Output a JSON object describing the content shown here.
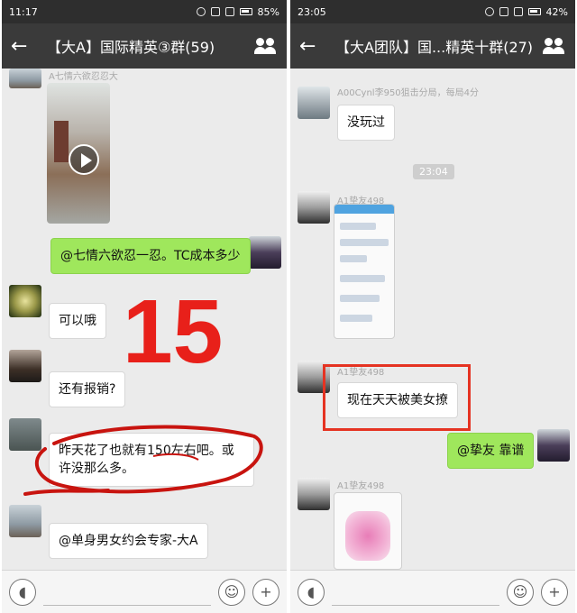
{
  "left": {
    "status": {
      "time": "11:17",
      "battery": "85%"
    },
    "title": "【大A】国际精英③群(59)",
    "messages": [
      {
        "sender": "A七情六欲忍忍大"
      },
      {
        "text": "@七情六欲忍一忍。TC成本多少"
      },
      {
        "text": "可以哦"
      },
      {
        "text": "还有报销?"
      },
      {
        "text": "昨天花了也就有150左右吧。或许没那么多。"
      },
      {
        "text": "@单身男女约会专家-大A"
      }
    ],
    "annotation_number": "15"
  },
  "right": {
    "status": {
      "time": "23:05",
      "battery": "42%"
    },
    "title": "【大A团队】国...精英十群(27)",
    "messages": [
      {
        "sender": "A00Cynl李950狙击分局，每局4分"
      },
      {
        "text": "没玩过"
      },
      {
        "time": "23:04"
      },
      {
        "sender": "A1挚友498"
      },
      {
        "sender": "A1挚友498"
      },
      {
        "text": "现在天天被美女撩"
      },
      {
        "text": "@挚友 靠谱"
      },
      {
        "sender": "A1挚友498"
      }
    ]
  },
  "colors": {
    "red_annotation": "#e8201a",
    "green_bubble": "#9fe75c",
    "titlebar": "#3a3a3a"
  }
}
